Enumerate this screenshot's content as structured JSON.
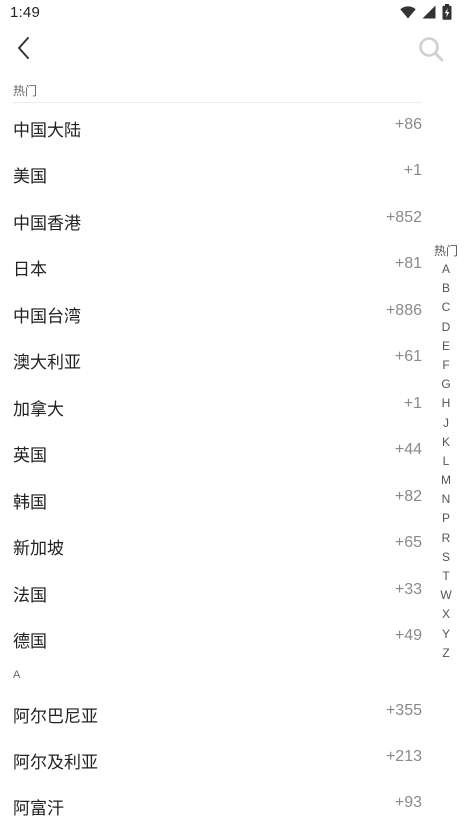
{
  "status_bar": {
    "time": "1:49"
  },
  "toolbar": {
    "back_icon": "chevron-left-icon",
    "search_icon": "search-icon"
  },
  "sections": {
    "hot_label": "热门",
    "a_label": "A"
  },
  "hot_countries": [
    {
      "name": "中国大陆",
      "code": "+86"
    },
    {
      "name": "美国",
      "code": "+1"
    },
    {
      "name": "中国香港",
      "code": "+852"
    },
    {
      "name": "日本",
      "code": "+81"
    },
    {
      "name": "中国台湾",
      "code": "+886"
    },
    {
      "name": "澳大利亚",
      "code": "+61"
    },
    {
      "name": "加拿大",
      "code": "+1"
    },
    {
      "name": "英国",
      "code": "+44"
    },
    {
      "name": "韩国",
      "code": "+82"
    },
    {
      "name": "新加坡",
      "code": "+65"
    },
    {
      "name": "法国",
      "code": "+33"
    },
    {
      "name": "德国",
      "code": "+49"
    }
  ],
  "a_countries": [
    {
      "name": "阿尔巴尼亚",
      "code": "+355"
    },
    {
      "name": "阿尔及利亚",
      "code": "+213"
    },
    {
      "name": "阿富汗",
      "code": "+93"
    }
  ],
  "index_letters": [
    "热门",
    "A",
    "B",
    "C",
    "D",
    "E",
    "F",
    "G",
    "H",
    "J",
    "K",
    "L",
    "M",
    "N",
    "P",
    "R",
    "S",
    "T",
    "W",
    "X",
    "Y",
    "Z"
  ]
}
